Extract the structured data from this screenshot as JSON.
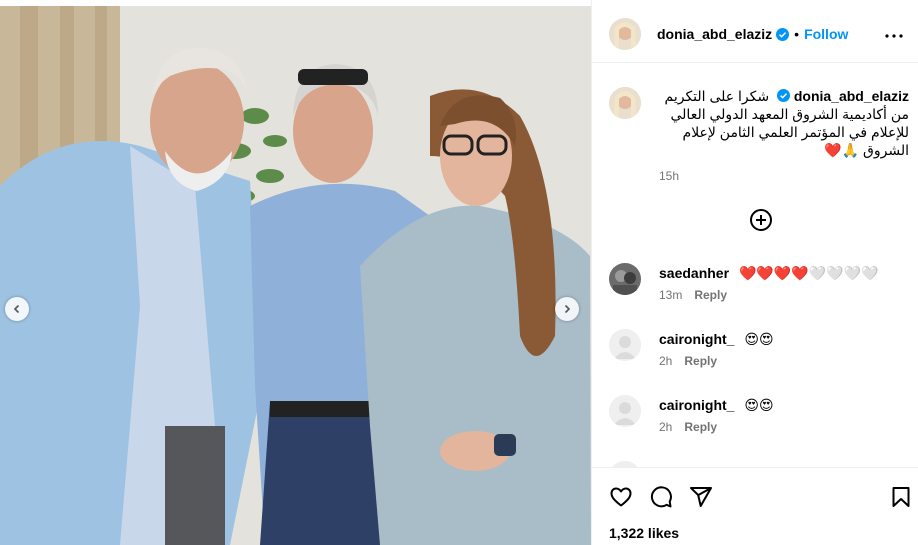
{
  "post": {
    "author": "donia_abd_elaziz",
    "follow_label": "Follow",
    "dot": "•",
    "caption": "شكرا على التكريم من أكاديمية الشروق المعهد الدولي العالي للإعلام في المؤتمر العلمي الثامن لإعلام الشروق 🙏❤️",
    "caption_time": "15h",
    "likes": "1,322 likes"
  },
  "comments": [
    {
      "user": "saedanher",
      "text": "❤️❤️❤️❤️🤍🤍🤍🤍",
      "time": "13m",
      "reply": "Reply"
    },
    {
      "user": "caironight_",
      "text": "😍😍",
      "time": "2h",
      "reply": "Reply"
    },
    {
      "user": "caironight_",
      "text": "😍😍",
      "time": "2h",
      "reply": "Reply"
    }
  ],
  "icons": {
    "verified": "verified-badge-icon",
    "more": "more-options-icon",
    "load_more": "plus-circle-icon",
    "like": "heart-icon",
    "comment": "comment-icon",
    "share": "send-icon",
    "save": "bookmark-icon",
    "prev": "chevron-left-icon",
    "next": "chevron-right-icon"
  },
  "colors": {
    "link": "#0095f6",
    "muted": "#737373",
    "verified": "#0095f6",
    "border": "#efefef"
  }
}
